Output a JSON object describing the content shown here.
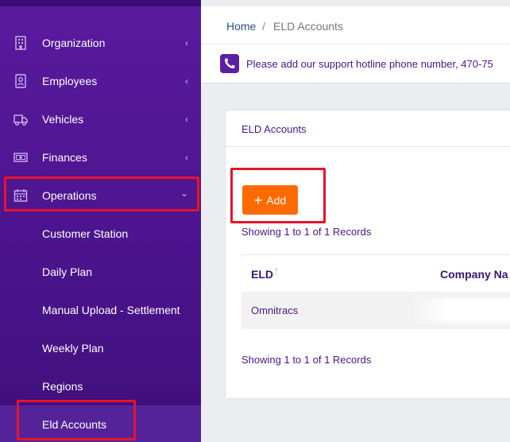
{
  "sidebar": {
    "items": [
      {
        "label": "Organization",
        "icon": "building-icon",
        "chevron": "‹"
      },
      {
        "label": "Employees",
        "icon": "id-badge-icon",
        "chevron": "‹"
      },
      {
        "label": "Vehicles",
        "icon": "truck-icon",
        "chevron": "‹"
      },
      {
        "label": "Finances",
        "icon": "money-icon",
        "chevron": "‹"
      },
      {
        "label": "Operations",
        "icon": "calendar-icon",
        "chevron": "⌄"
      }
    ],
    "subitems": [
      "Customer Station",
      "Daily Plan",
      "Manual Upload - Settlement",
      "Weekly Plan",
      "Regions",
      "Eld Accounts"
    ],
    "active_subitem": "Eld Accounts"
  },
  "breadcrumb": {
    "home": "Home",
    "separator": "/",
    "current": "ELD Accounts"
  },
  "notice": {
    "text": "Please add our support hotline phone number, 470-75",
    "icon": "phone-icon"
  },
  "card": {
    "title": "ELD Accounts",
    "add_label": "Add",
    "showing_top": "Showing 1 to 1 of 1 Records",
    "showing_bottom": "Showing 1 to 1 of 1 Records",
    "columns": [
      "ELD",
      "Company Na"
    ],
    "rows": [
      {
        "eld": "Omnitracs",
        "company": ""
      }
    ]
  },
  "colors": {
    "sidebar": "#4a148c",
    "accent": "#ff6a00",
    "highlight": "#e8132b"
  }
}
